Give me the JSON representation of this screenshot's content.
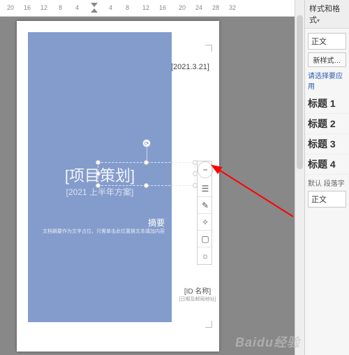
{
  "ruler": {
    "marks": [
      "20",
      "16",
      "12",
      "8",
      "4",
      "",
      "4",
      "8",
      "12",
      "16",
      "20",
      "24",
      "28",
      "32"
    ]
  },
  "document": {
    "date": "[2021.3.21]",
    "title": "[项目策划]",
    "subtitle": "[2021 上半年方案]",
    "abstract_heading": "摘要",
    "abstract_text": "文档摘要作为文字占位，只需单击此位置换文本填加内容",
    "id_name": "[ID 名称]",
    "id_sub": "[日期及邮局地址]"
  },
  "float_toolbar": {
    "items": [
      {
        "name": "collapse-icon",
        "glyph": "−"
      },
      {
        "name": "layout-icon",
        "glyph": "☰"
      },
      {
        "name": "edit-icon",
        "glyph": "✎"
      },
      {
        "name": "effects-icon",
        "glyph": "✧"
      },
      {
        "name": "frame-icon",
        "glyph": "▢"
      },
      {
        "name": "idea-icon",
        "glyph": "☼"
      }
    ]
  },
  "sidebar": {
    "header": "样式和格式",
    "dropdown_hint": "▾",
    "current_style": "正文",
    "new_style_btn": "新样式…",
    "apply_hint": "请选择要应用",
    "headings": [
      "标题 1",
      "标题 2",
      "标题 3",
      "标题 4"
    ],
    "default_note": "默认 段落字",
    "bottom_select": "正文"
  },
  "watermark": "Baidu经验"
}
